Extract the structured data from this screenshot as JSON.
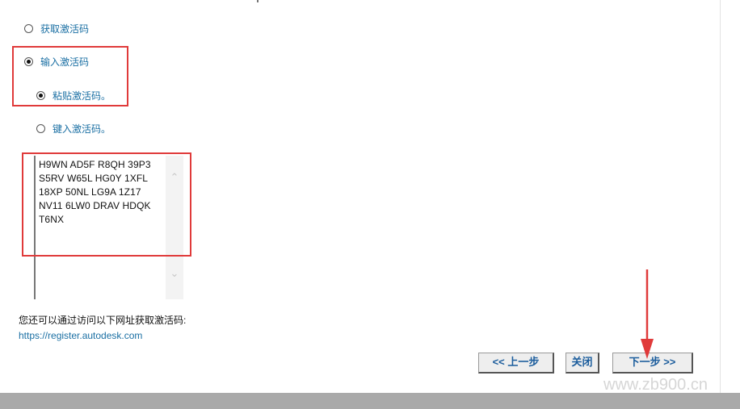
{
  "options": {
    "get_code_label": "获取激活码",
    "enter_code_label": "输入激活码",
    "paste_code_label": "粘贴激活码。",
    "type_code_label": "键入激活码。"
  },
  "activation_code": {
    "value": "H9WN AD5F R8QH 39P3\nS5RV W65L HG0Y 1XFL\n18XP 50NL LG9A 1Z17\nNV11 6LW0 DRAV HDQK\nT6NX"
  },
  "info": {
    "text": "您还可以通过访问以下网址获取激活码:",
    "url": "https://register.autodesk.com"
  },
  "buttons": {
    "back": "<< 上一步",
    "close": "关闭",
    "next": "下一步 >>"
  },
  "watermark": "www.zb900.cn",
  "colors": {
    "highlight_box": "#e03a3a",
    "link": "#1a6fa3",
    "button_text": "#1a5c9c"
  }
}
